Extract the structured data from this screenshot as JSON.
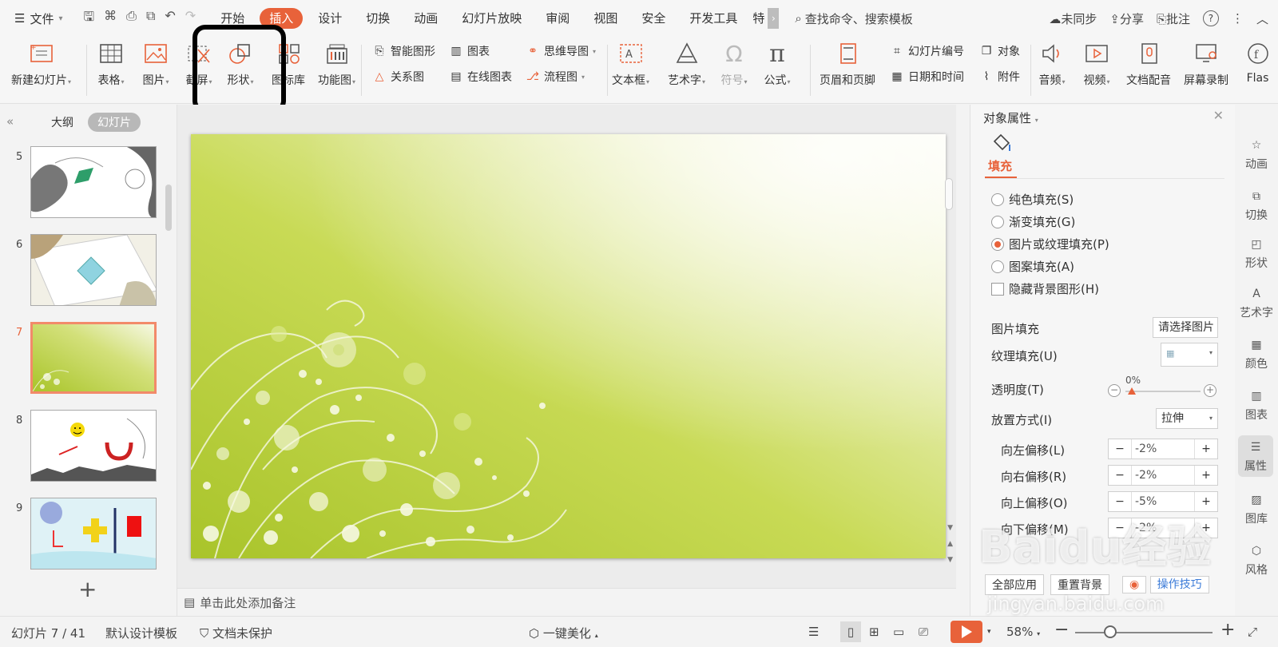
{
  "menubar": {
    "file_label": "文件",
    "tabs": [
      "开始",
      "插入",
      "设计",
      "切换",
      "动画",
      "幻灯片放映",
      "审阅",
      "视图",
      "安全",
      "开发工具",
      "特"
    ],
    "active_tab": "插入",
    "search_label": "查找命令、搜索模板",
    "sync_label": "未同步",
    "share_label": "分享",
    "annotate_label": "批注"
  },
  "ribbon": {
    "new_slide": "新建幻灯片",
    "table": "表格",
    "picture": "图片",
    "screenshot": "截屏",
    "shape": "形状",
    "icon_library": "图标库",
    "function_chart": "功能图",
    "smartart": "智能图形",
    "chart": "图表",
    "mindmap": "思维导图",
    "relation": "关系图",
    "online_chart": "在线图表",
    "flowchart": "流程图",
    "textbox": "文本框",
    "wordart": "艺术字",
    "symbol": "符号",
    "formula": "公式",
    "header_footer": "页眉和页脚",
    "slide_number": "幻灯片编号",
    "object": "对象",
    "datetime": "日期和时间",
    "attachment": "附件",
    "audio": "音频",
    "video": "视频",
    "doc_voice": "文档配音",
    "screen_record": "屏幕录制",
    "flash": "Flas"
  },
  "leftpanel": {
    "tab_outline": "大纲",
    "tab_slides": "幻灯片",
    "slides": [
      {
        "num": "5",
        "current": false
      },
      {
        "num": "6",
        "current": false
      },
      {
        "num": "7",
        "current": true
      },
      {
        "num": "8",
        "current": false
      },
      {
        "num": "9",
        "current": false
      }
    ],
    "add_slide": "+"
  },
  "notes_placeholder": "单击此处添加备注",
  "props": {
    "title": "对象属性",
    "fill_tab": "填充",
    "options": [
      {
        "label": "纯色填充(S)",
        "selected": false
      },
      {
        "label": "渐变填充(G)",
        "selected": false
      },
      {
        "label": "图片或纹理填充(P)",
        "selected": true
      },
      {
        "label": "图案填充(A)",
        "selected": false
      }
    ],
    "hide_bg": "隐藏背景图形(H)",
    "picture_fill_label": "图片填充",
    "picture_fill_value": "请选择图片",
    "texture_fill_label": "纹理填充(U)",
    "transparency_label": "透明度(T)",
    "transparency_value": "0%",
    "placement_label": "放置方式(I)",
    "placement_value": "拉伸",
    "offsets": [
      {
        "label": "向左偏移(L)",
        "value": "-2%"
      },
      {
        "label": "向右偏移(R)",
        "value": "-2%"
      },
      {
        "label": "向上偏移(O)",
        "value": "-5%"
      },
      {
        "label": "向下偏移(M)",
        "value": "-2%"
      }
    ],
    "apply_all": "全部应用",
    "reset_bg": "重置背景",
    "tips": "操作技巧"
  },
  "sidestrip": [
    "动画",
    "切换",
    "形状",
    "艺术字",
    "颜色",
    "图表",
    "属性",
    "图库",
    "风格"
  ],
  "statusbar": {
    "slide_info": "幻灯片 7 / 41",
    "template": "默认设计模板",
    "protect": "文档未保护",
    "beautify": "一键美化",
    "zoom": "58%"
  },
  "watermark": {
    "brand": "Baidu经验",
    "url": "jingyan.baidu.com"
  },
  "colors": {
    "accent": "#e8623a",
    "slide_bg_dark": "#b5cf3a",
    "slide_bg_light": "#f4f7dc"
  }
}
